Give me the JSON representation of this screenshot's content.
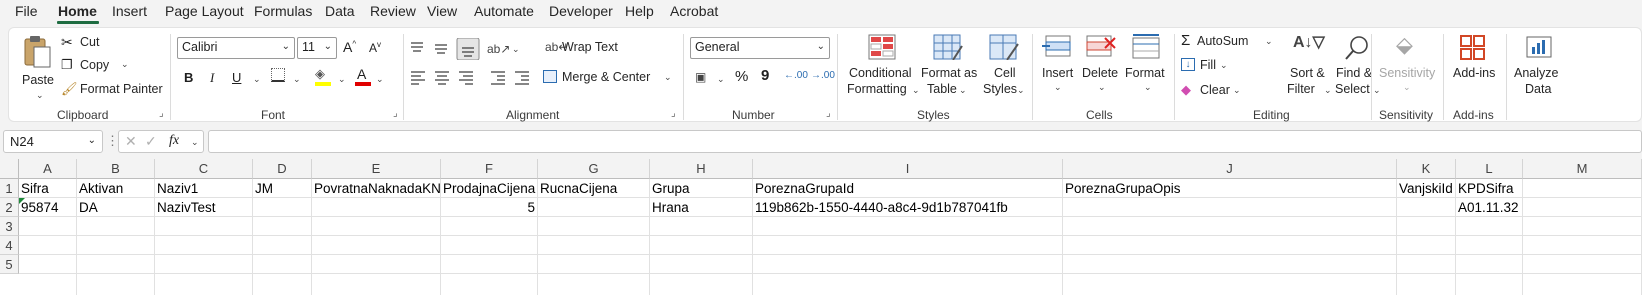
{
  "menu": {
    "items": [
      "File",
      "Home",
      "Insert",
      "Page Layout",
      "Formulas",
      "Data",
      "Review",
      "View",
      "Automate",
      "Developer",
      "Help",
      "Acrobat"
    ],
    "active": "Home"
  },
  "ribbon": {
    "clipboard": {
      "paste": "Paste",
      "cut": "Cut",
      "copy": "Copy",
      "format_painter": "Format Painter",
      "label": "Clipboard"
    },
    "font": {
      "name": "Calibri",
      "size": "11",
      "bold": "B",
      "italic": "I",
      "underline": "U",
      "label": "Font",
      "highlight_color": "#ffff00",
      "font_color": "#e00000"
    },
    "alignment": {
      "wrap_text": "Wrap Text",
      "merge_center": "Merge & Center",
      "label": "Alignment"
    },
    "number": {
      "format": "General",
      "percent": "%",
      "comma": "9",
      "inc_decimal": ".00",
      "dec_decimal": ".00",
      "label": "Number"
    },
    "styles": {
      "conditional_1": "Conditional",
      "conditional_2": "Formatting",
      "format_table_1": "Format as",
      "format_table_2": "Table",
      "cell_styles_1": "Cell",
      "cell_styles_2": "Styles",
      "label": "Styles"
    },
    "cells": {
      "insert": "Insert",
      "delete": "Delete",
      "format": "Format",
      "label": "Cells"
    },
    "editing": {
      "autosum": "AutoSum",
      "fill": "Fill",
      "clear": "Clear",
      "sort_1": "Sort &",
      "sort_2": "Filter",
      "find_1": "Find &",
      "find_2": "Select",
      "label": "Editing"
    },
    "sensitivity": {
      "button": "Sensitivity",
      "label": "Sensitivity"
    },
    "addins": {
      "button": "Add-ins",
      "label": "Add-ins"
    },
    "analyze": {
      "button_1": "Analyze",
      "button_2": "Data"
    }
  },
  "formula_bar": {
    "name_box": "N24",
    "fx": "fx",
    "value": ""
  },
  "sheet": {
    "columns": [
      "A",
      "B",
      "C",
      "D",
      "E",
      "F",
      "G",
      "H",
      "I",
      "J",
      "K",
      "L",
      "M"
    ],
    "rows": [
      "1",
      "2",
      "3",
      "4",
      "5"
    ],
    "cells": {
      "r1": [
        "Sifra",
        "Aktivan",
        "Naziv1",
        "JM",
        "PovratnaNaknadaKN",
        "ProdajnaCijena",
        "RucnaCijena",
        "Grupa",
        "PoreznaGrupaId",
        "PoreznaGrupaOpis",
        "VanjskiId",
        "KPDSifra",
        ""
      ],
      "r2": [
        "95874",
        "DA",
        "NazivTest",
        "",
        "",
        "5",
        "",
        "Hrana",
        "119b862b-1550-4440-a8c4-9d1b787041fb",
        "",
        "",
        "A01.11.32",
        ""
      ]
    }
  }
}
